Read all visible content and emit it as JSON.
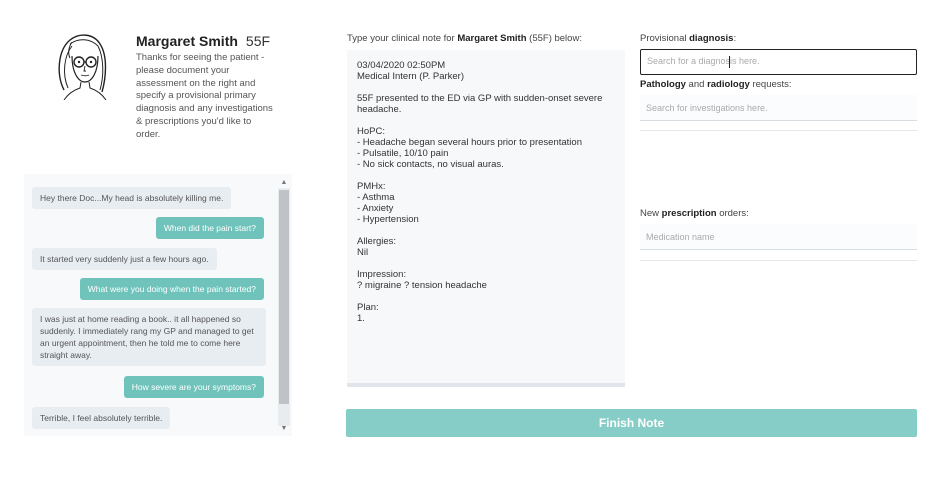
{
  "patient": {
    "name": "Margaret Smith",
    "age_sex": "55F",
    "description": "Thanks for seeing the patient - please document your assessment on the right and specify a provisional primary diagnosis and any investigations & prescriptions you'd like to order."
  },
  "chat": {
    "messages": [
      {
        "from": "patient",
        "text": "Hey there Doc...My head is absolutely killing me."
      },
      {
        "from": "doctor",
        "text": "When did the pain start?"
      },
      {
        "from": "patient",
        "text": "It started very suddenly just a few hours ago."
      },
      {
        "from": "doctor",
        "text": "What were you doing when the pain started?"
      },
      {
        "from": "patient",
        "text": "I was just at home reading a book.. it all happened so suddenly. I immediately rang my GP and managed to get an urgent appointment, then he told me to come here straight away."
      },
      {
        "from": "doctor",
        "text": "How severe are your symptoms?"
      },
      {
        "from": "patient",
        "text": "Terrible, I feel absolutely terrible."
      }
    ]
  },
  "note": {
    "label_prefix": "Type your clinical note for ",
    "label_name": "Margaret Smith",
    "label_suffix": " (55F) below:",
    "text": "03/04/2020 02:50PM\nMedical Intern (P. Parker)\n\n55F presented to the ED via GP with sudden-onset severe headache.\n\nHoPC:\n- Headache began several hours prior to presentation\n- Pulsatile, 10/10 pain\n- No sick contacts, no visual auras.\n\nPMHx:\n- Asthma\n- Anxiety\n- Hypertension\n\nAllergies:\nNil\n\nImpression:\n? migraine ? tension headache\n\nPlan:\n1."
  },
  "diagnosis": {
    "label_prefix": "Provisional ",
    "label_bold": "diagnosis",
    "label_suffix": ":",
    "placeholder": "Search for a diagnosis here."
  },
  "investigations": {
    "label_bold1": "Pathology",
    "label_mid": " and ",
    "label_bold2": "radiology",
    "label_suffix": " requests:",
    "placeholder": "Search for investigations here."
  },
  "prescriptions": {
    "label_prefix": "New ",
    "label_bold": "prescription",
    "label_suffix": " orders:",
    "placeholder": "Medication name"
  },
  "finish_label": "Finish Note",
  "colors": {
    "accent": "#85cdc6",
    "doctor_bubble": "#6fc3bb",
    "patient_bubble": "#e8edf2"
  }
}
